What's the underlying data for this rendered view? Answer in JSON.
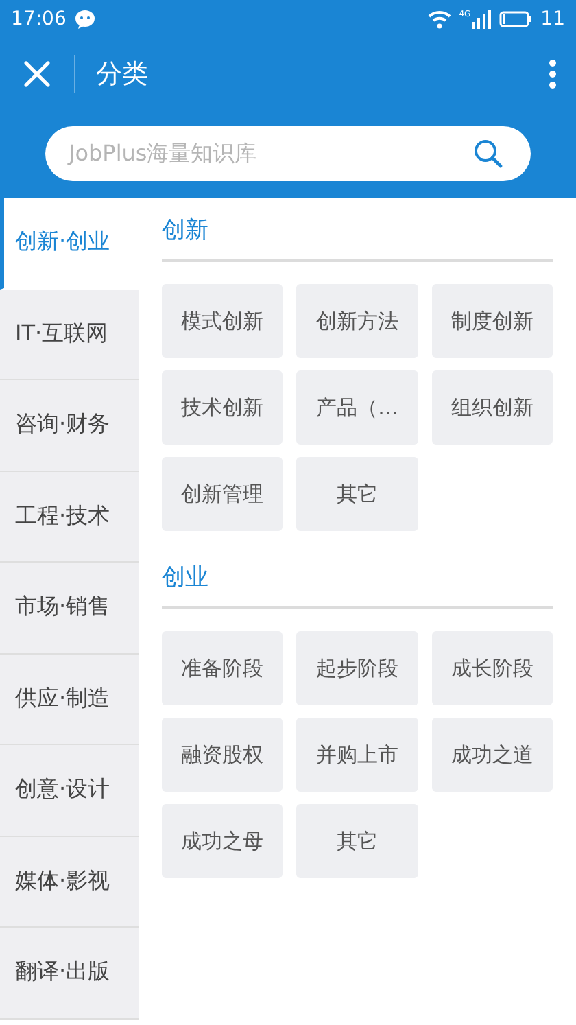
{
  "status_bar": {
    "time": "17:06",
    "network": "4G",
    "battery": "11"
  },
  "app_bar": {
    "title": "分类"
  },
  "search": {
    "placeholder": "JobPlus海量知识库"
  },
  "sidebar": {
    "items": [
      {
        "label": "创新·创业",
        "selected": true
      },
      {
        "label": "IT·互联网",
        "selected": false
      },
      {
        "label": "咨询·财务",
        "selected": false
      },
      {
        "label": "工程·技术",
        "selected": false
      },
      {
        "label": "市场·销售",
        "selected": false
      },
      {
        "label": "供应·制造",
        "selected": false
      },
      {
        "label": "创意·设计",
        "selected": false
      },
      {
        "label": "媒体·影视",
        "selected": false
      },
      {
        "label": "翻译·出版",
        "selected": false
      }
    ]
  },
  "sections": [
    {
      "title": "创新",
      "tags": [
        "模式创新",
        "创新方法",
        "制度创新",
        "技术创新",
        "产品（…",
        "组织创新",
        "创新管理",
        "其它"
      ]
    },
    {
      "title": "创业",
      "tags": [
        "准备阶段",
        "起步阶段",
        "成长阶段",
        "融资股权",
        "并购上市",
        "成功之道",
        "成功之母",
        "其它"
      ]
    }
  ]
}
